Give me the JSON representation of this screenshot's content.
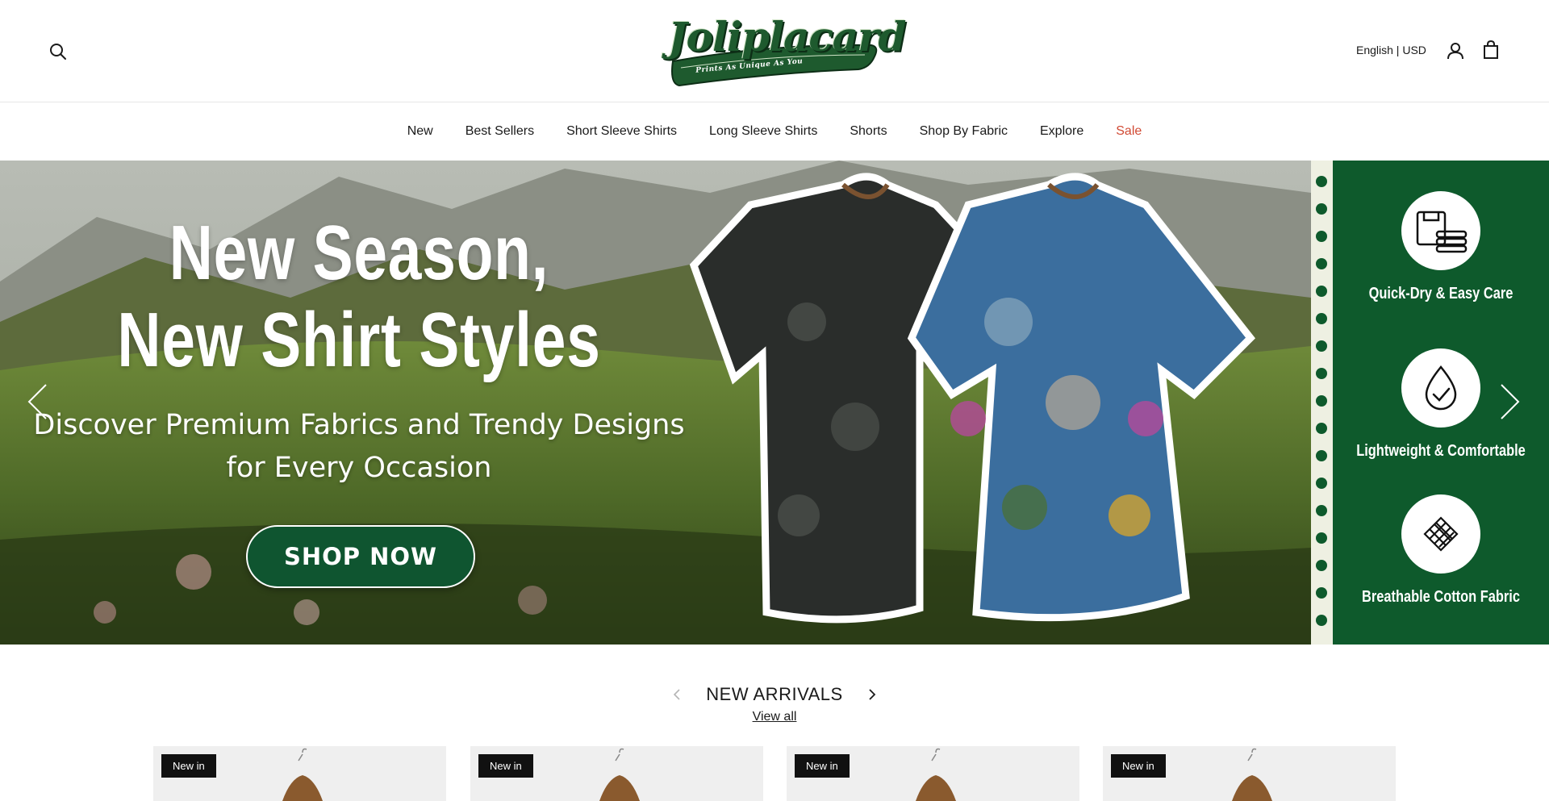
{
  "header": {
    "logo": {
      "wordmark": "Joliplacard",
      "tagline": "Prints As Unique As You"
    },
    "locale": "English | USD",
    "icons": [
      "search-icon",
      "account-icon",
      "cart-icon"
    ]
  },
  "nav": {
    "items": [
      {
        "label": "New"
      },
      {
        "label": "Best Sellers"
      },
      {
        "label": "Short Sleeve Shirts"
      },
      {
        "label": "Long Sleeve Shirts"
      },
      {
        "label": "Shorts"
      },
      {
        "label": "Shop By Fabric"
      },
      {
        "label": "Explore"
      },
      {
        "label": "Sale",
        "color": "#d14a34"
      }
    ]
  },
  "hero": {
    "title_line1": "New Season,",
    "title_line2": "New Shirt Styles",
    "subtitle_line1": "Discover Premium Fabrics and Trendy Designs",
    "subtitle_line2": "for Every Occasion",
    "cta": "SHOP NOW",
    "features": [
      {
        "label": "Quick-Dry & Easy Care",
        "icon": "shirt-stack-icon"
      },
      {
        "label": "Lightweight & Comfortable",
        "icon": "droplet-check-icon"
      },
      {
        "label": "Breathable Cotton Fabric",
        "icon": "fabric-weave-icon"
      }
    ],
    "colors": {
      "panel": "#0e5a2c",
      "strip": "#eef0e2",
      "cta": "#0f5530"
    }
  },
  "section": {
    "title": "NEW ARRIVALS",
    "view_all": "View all"
  },
  "products": [
    {
      "badge": "New in"
    },
    {
      "badge": "New in"
    },
    {
      "badge": "New in"
    },
    {
      "badge": "New in"
    }
  ]
}
